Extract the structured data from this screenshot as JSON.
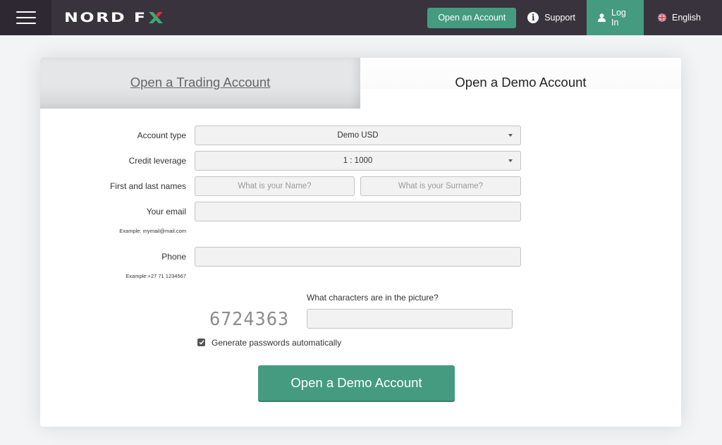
{
  "header": {
    "brand": {
      "text": "NORD F",
      "accent_letter": "X"
    },
    "open_account_label": "Open an Account",
    "support_label": "Support",
    "login_label": "Log In",
    "language_label": "English",
    "icons": {
      "menu": "hamburger-icon",
      "support": "info-icon",
      "login": "user-icon",
      "language": "uk-flag-icon"
    }
  },
  "colors": {
    "header_bg": "#38333d",
    "accent_green": "#459b80",
    "logo_red": "#d9343a",
    "logo_green": "#3aaa6e"
  },
  "tabs": [
    {
      "label": "Open a Trading Account",
      "active": false
    },
    {
      "label": "Open a Demo Account",
      "active": true
    }
  ],
  "form": {
    "account_type": {
      "label": "Account type",
      "value": "Demo USD"
    },
    "credit_leverage": {
      "label": "Credit leverage",
      "value": "1 : 1000"
    },
    "names": {
      "label": "First and last names",
      "first_placeholder": "What is your Name?",
      "last_placeholder": "What is your Surname?",
      "first_value": "",
      "last_value": ""
    },
    "email": {
      "label": "Your email",
      "hint": "Example: mymail@mail.com",
      "value": ""
    },
    "phone": {
      "label": "Phone",
      "hint": "Example:+27 71 1234567",
      "value": ""
    },
    "captcha": {
      "question": "What characters are in the picture?",
      "image_text": "6724363",
      "value": ""
    },
    "generate_passwords": {
      "label": "Generate passwords automatically",
      "checked": true
    },
    "submit_label": "Open a Demo Account"
  }
}
